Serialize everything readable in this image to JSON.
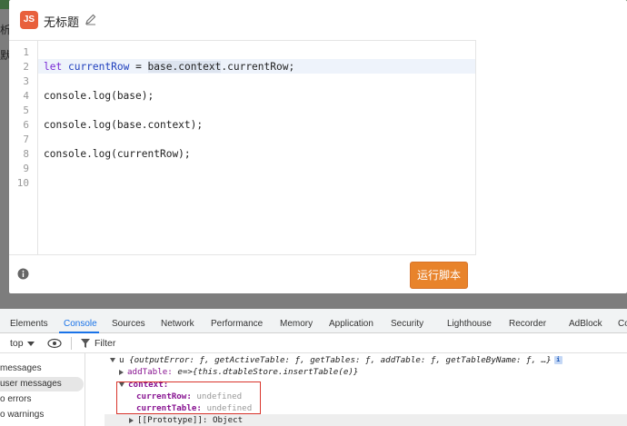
{
  "background": {
    "glyphs": [
      "析",
      "默"
    ]
  },
  "dialog": {
    "badge": "JS",
    "title": "无标题",
    "icons": [
      "pencil-icon",
      "info-icon"
    ],
    "run_button": "运行脚本",
    "accent": "#e8832b"
  },
  "editor": {
    "line_numbers": [
      "1",
      "2",
      "3",
      "4",
      "5",
      "6",
      "7",
      "8",
      "9",
      "10"
    ],
    "active_line": 2,
    "lines": [
      "",
      "let currentRow = base.context.currentRow;",
      "",
      "console.log(base);",
      "",
      "console.log(base.context);",
      "",
      "console.log(currentRow);",
      "",
      ""
    ],
    "line2": {
      "kw": "let",
      "var": "currentRow",
      "eq": " = ",
      "hl": "base.context",
      "rest": ".currentRow;"
    }
  },
  "devtools": {
    "tabs": [
      "Elements",
      "Console",
      "Sources",
      "Network",
      "Performance",
      "Memory",
      "Application",
      "Security",
      "Lighthouse",
      "Recorder",
      "AdBlock",
      "Co"
    ],
    "active_tab": "Console",
    "context_select": "top",
    "filter_placeholder": "Filter",
    "sidebar": [
      "messages",
      "user messages",
      "o errors",
      "o warnings"
    ],
    "sidebar_selected": "user messages",
    "console": {
      "line1_prefix": "u ",
      "line1_obj": "{outputError: ƒ, getActiveTable: ƒ, getTables: ƒ, addTable: ƒ, getTableByName: ƒ, …}",
      "line2_key": "addTable:",
      "line2_val": " e=>{this.dtableStore.insertTable(e)}",
      "line3_key": "context:",
      "line4_key": "currentRow:",
      "line4_val": " undefined",
      "line5_key": "currentTable:",
      "line5_val": " undefined",
      "line6": "[[Prototype]]: Object"
    }
  }
}
